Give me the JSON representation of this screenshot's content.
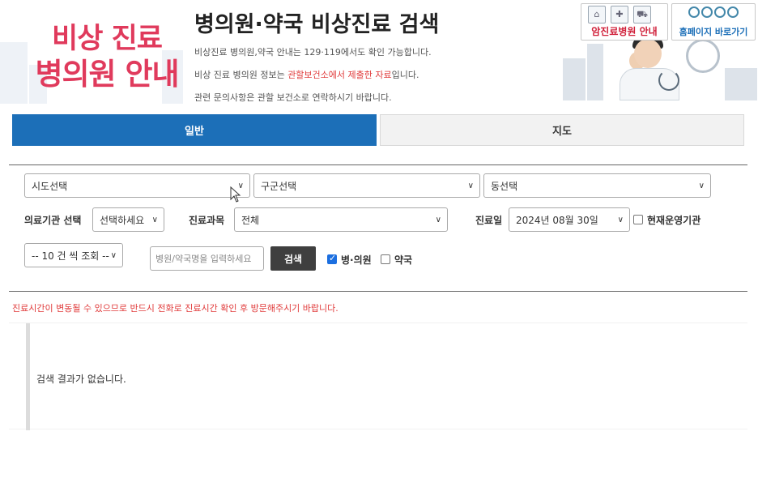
{
  "header": {
    "logo_line1": "비상 진료",
    "logo_line2": "병의원 안내",
    "title": "병의원·약국 비상진료 검색",
    "info1": "비상진료 병의원,약국 안내는 129·119에서도 확인 가능합니다.",
    "info2_pre": "비상 진료 병의원 정보는 ",
    "info2_highlight": "관할보건소에서 제출한 자료",
    "info2_post": "입니다.",
    "info3": "관련 문의사항은 관할 보건소로 연락하시기 바랍니다.",
    "cancer_btn": "암진료병원 안내",
    "home_btn": "홈페이지 바로가기"
  },
  "tabs": [
    {
      "label": "일반",
      "active": true
    },
    {
      "label": "지도",
      "active": false
    }
  ],
  "filters": {
    "sido": "시도선택",
    "gugun": "구군선택",
    "dong": "동선택",
    "inst_label": "의료기관 선택",
    "inst_value": "선택하세요",
    "dept_label": "진료과목",
    "dept_value": "전체",
    "date_label": "진료일",
    "date_value": "2024년 08월 30일",
    "open_now_label": "현재운영기관",
    "page_size": "-- 10 건 씩 조회 --",
    "search_placeholder": "병원/약국명을 입력하세요",
    "search_button": "검색",
    "hospital_label": "병·의원",
    "pharmacy_label": "약국",
    "hospital_checked": true,
    "pharmacy_checked": false,
    "open_now_checked": false
  },
  "notice": "진료시간이 변동될 수 있으므로 반드시 전화로 진료시간 확인 후 방문해주시기 바랍니다.",
  "results": {
    "empty_message": "검색 결과가 없습니다."
  },
  "colors": {
    "primary": "#1c6fb8",
    "logo": "#e03a5c",
    "highlight": "#e03a3a"
  }
}
